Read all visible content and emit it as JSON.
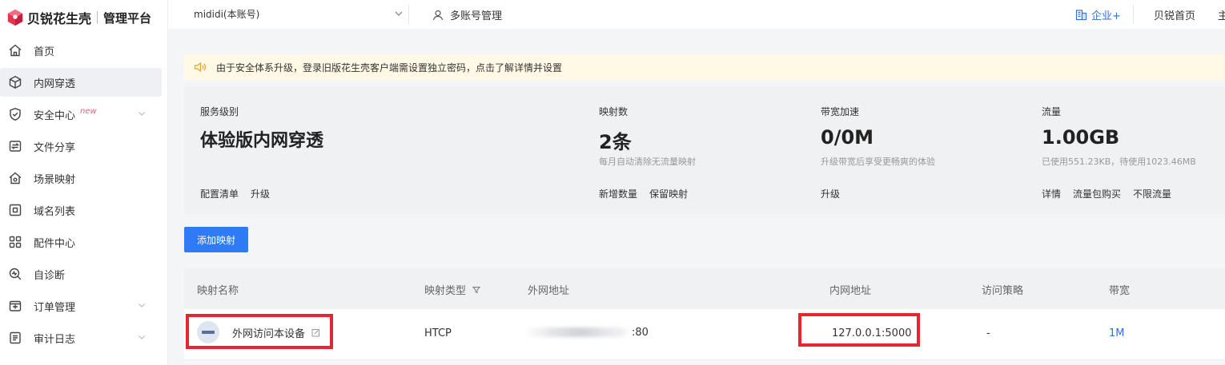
{
  "brand": {
    "name": "贝锐花生壳",
    "subtitle": "管理平台"
  },
  "sidebar": {
    "items": [
      {
        "label": "首页",
        "icon": "home-icon",
        "active": false,
        "new": "",
        "expandable": false
      },
      {
        "label": "内网穿透",
        "icon": "cube-icon",
        "active": true,
        "new": "",
        "expandable": false
      },
      {
        "label": "安全中心",
        "icon": "shield-icon",
        "active": false,
        "new": "new",
        "expandable": true
      },
      {
        "label": "文件分享",
        "icon": "share-icon",
        "active": false,
        "new": "",
        "expandable": false
      },
      {
        "label": "场景映射",
        "icon": "scene-icon",
        "active": false,
        "new": "",
        "expandable": false
      },
      {
        "label": "域名列表",
        "icon": "domain-icon",
        "active": false,
        "new": "",
        "expandable": false
      },
      {
        "label": "配件中心",
        "icon": "apps-icon",
        "active": false,
        "new": "",
        "expandable": false
      },
      {
        "label": "自诊断",
        "icon": "diagnose-icon",
        "active": false,
        "new": "",
        "expandable": false
      },
      {
        "label": "订单管理",
        "icon": "order-icon",
        "active": false,
        "new": "",
        "expandable": true
      },
      {
        "label": "审计日志",
        "icon": "log-icon",
        "active": false,
        "new": "",
        "expandable": true
      }
    ]
  },
  "topbar": {
    "account": "mididi(本账号)",
    "multi_account": "多账号管理",
    "enterprise": "企业+",
    "home": "贝锐首页",
    "more": "主"
  },
  "notice": {
    "text": "由于安全体系升级，登录旧版花生壳客户端需设置独立密码，点击了解详情并设置"
  },
  "stats": {
    "service": {
      "label": "服务级别",
      "value": "体验版内网穿透",
      "desc": "",
      "links": [
        "配置清单",
        "升级"
      ]
    },
    "mappings": {
      "label": "映射数",
      "value": "2条",
      "desc": "每月自动清除无流量映射",
      "links": [
        "新增数量",
        "保留映射"
      ]
    },
    "bandwidth": {
      "label": "带宽加速",
      "value": "0/0M",
      "desc": "升级带宽后享受更畅爽的体验",
      "links": [
        "升级"
      ]
    },
    "traffic": {
      "label": "流量",
      "value": "1.00GB",
      "desc": "已使用551.23KB，待使用1023.46MB",
      "links": [
        "详情",
        "流量包购买",
        "不限流量"
      ]
    }
  },
  "add_button": "添加映射",
  "table": {
    "columns": [
      "映射名称",
      "映射类型",
      "外网地址",
      "内网地址",
      "访问策略",
      "带宽"
    ],
    "rows": [
      {
        "name": "外网访问本设备",
        "type": "HTCP",
        "external_suffix": ":80",
        "internal": "127.0.0.1:5000",
        "policy": "-",
        "bandwidth": "1M"
      }
    ]
  },
  "colors": {
    "accent": "#2f7bf5",
    "highlight": "#e6262e",
    "notice_bg": "#fff9e6",
    "link": "#2f6fe6"
  }
}
